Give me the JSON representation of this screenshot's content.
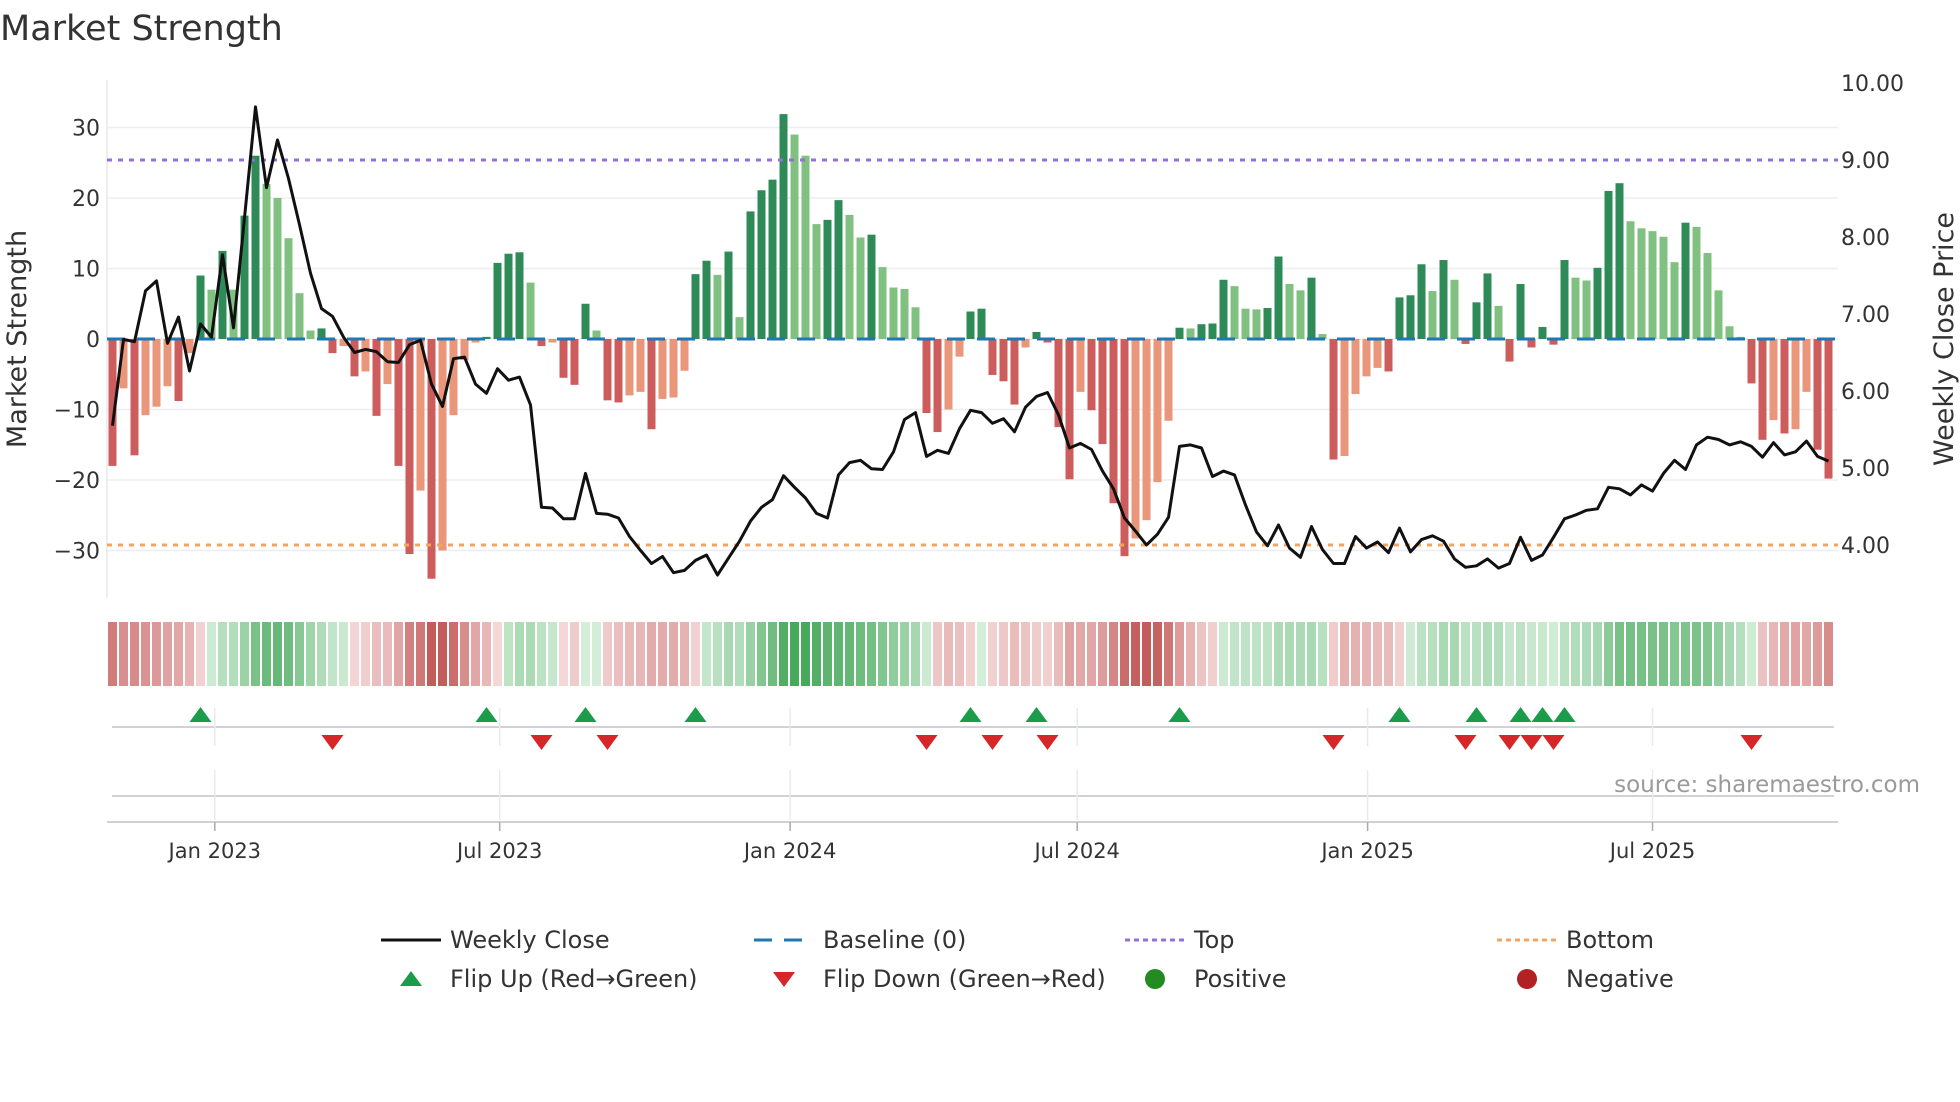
{
  "chart_data": {
    "type": "bar",
    "title": "Market Strength",
    "ylabel": "Market Strength",
    "y2label": "Weekly Close Price",
    "ylim": [
      -36,
      36
    ],
    "y2lim": [
      3.0,
      10.0
    ],
    "grid": true,
    "legend_position": "bottom",
    "yticks": [
      {
        "v": 30,
        "label": "30"
      },
      {
        "v": 20,
        "label": "20"
      },
      {
        "v": 10,
        "label": "10"
      },
      {
        "v": 0,
        "label": "0"
      },
      {
        "v": -10,
        "label": "−10"
      },
      {
        "v": -20,
        "label": "−20"
      },
      {
        "v": -30,
        "label": "−30"
      }
    ],
    "y2ticks": [
      {
        "v": 10,
        "label": "10.00"
      },
      {
        "v": 9,
        "label": "9.00"
      },
      {
        "v": 8,
        "label": "8.00"
      },
      {
        "v": 7,
        "label": "7.00"
      },
      {
        "v": 6,
        "label": "6.00"
      },
      {
        "v": 5,
        "label": "5.00"
      },
      {
        "v": 4,
        "label": "4.00"
      }
    ],
    "xticks": [
      {
        "week": 9.3,
        "label": "Jan 2023"
      },
      {
        "week": 35.2,
        "label": "Jul 2023"
      },
      {
        "week": 61.6,
        "label": "Jan 2024"
      },
      {
        "week": 87.7,
        "label": "Jul 2024"
      },
      {
        "week": 114.1,
        "label": "Jan 2025"
      },
      {
        "week": 140.0,
        "label": "Jul 2025"
      }
    ],
    "top_level_price": 9.0,
    "bottom_level_price": 4.0,
    "strength": [
      -18,
      -7,
      -16.5,
      -10.8,
      -9.6,
      -6.7,
      -8.8,
      -2,
      9,
      7,
      12.5,
      7,
      17.5,
      26,
      22,
      20,
      14.3,
      6.5,
      1.2,
      1.5,
      -2,
      -1,
      -5.3,
      -4.6,
      -10.9,
      -6.4,
      -18,
      -30.5,
      -21.5,
      -34,
      -30,
      -10.8,
      -3,
      -0.5,
      0.3,
      10.8,
      12.1,
      12.3,
      8,
      -1,
      -0.5,
      -5.5,
      -6.5,
      5,
      1.2,
      -8.7,
      -9,
      -8,
      -7.5,
      -12.8,
      -8.5,
      -8.3,
      -4.5,
      9.2,
      11.1,
      9.1,
      12.4,
      3.1,
      18.1,
      21.1,
      22.6,
      31.9,
      29.0,
      26.0,
      16.3,
      16.9,
      19.7,
      17.6,
      14.4,
      14.8,
      10.2,
      7.3,
      7.1,
      4.5,
      -10.5,
      -13.2,
      -10.0,
      -2.5,
      3.9,
      4.3,
      -5.1,
      -6.0,
      -9.3,
      -1.2,
      1.0,
      -0.5,
      -12.5,
      -19.9,
      -7.5,
      -10.1,
      -14.9,
      -23.3,
      -30.8,
      -28.3,
      -25.7,
      -20.3,
      -11.6,
      1.6,
      1.5,
      2.1,
      2.2,
      8.4,
      7.5,
      4.3,
      4.2,
      4.4,
      11.7,
      7.8,
      6.9,
      8.7,
      0.7,
      -17.1,
      -16.6,
      -7.8,
      -5.3,
      -4.1,
      -4.6,
      5.9,
      6.2,
      10.6,
      6.8,
      11.2,
      8.4,
      -0.7,
      5.2,
      9.3,
      4.7,
      -3.2,
      7.8,
      -1.2,
      1.7,
      -0.8,
      11.2,
      8.7,
      8.3,
      10.1,
      21.0,
      22.1,
      16.7,
      15.7,
      15.3,
      14.5,
      10.9,
      16.5,
      15.9,
      12.2,
      6.9,
      1.8,
      0.3,
      -6.3,
      -14.3,
      -11.5,
      -13.4,
      -12.8,
      -7.5,
      -15.7,
      -19.8
    ],
    "weekly_close": [
      5.55,
      6.67,
      6.64,
      7.3,
      7.43,
      6.62,
      6.96,
      6.26,
      6.87,
      6.7,
      7.77,
      6.82,
      8.25,
      9.69,
      8.64,
      9.26,
      8.76,
      8.16,
      7.53,
      7.07,
      6.97,
      6.7,
      6.5,
      6.54,
      6.51,
      6.38,
      6.37,
      6.6,
      6.66,
      6.09,
      5.8,
      6.42,
      6.44,
      6.09,
      5.97,
      6.29,
      6.14,
      6.18,
      5.82,
      4.49,
      4.48,
      4.34,
      4.34,
      4.93,
      4.41,
      4.4,
      4.35,
      4.11,
      3.93,
      3.76,
      3.85,
      3.64,
      3.67,
      3.8,
      3.87,
      3.61,
      3.83,
      4.05,
      4.31,
      4.49,
      4.59,
      4.9,
      4.75,
      4.61,
      4.41,
      4.35,
      4.91,
      5.07,
      5.1,
      4.99,
      4.98,
      5.21,
      5.63,
      5.72,
      5.15,
      5.23,
      5.19,
      5.51,
      5.75,
      5.72,
      5.58,
      5.64,
      5.47,
      5.79,
      5.93,
      5.98,
      5.69,
      5.26,
      5.32,
      5.24,
      4.96,
      4.73,
      4.35,
      4.18,
      4.0,
      4.14,
      4.36,
      5.28,
      5.3,
      5.26,
      4.89,
      4.96,
      4.91,
      4.52,
      4.17,
      3.99,
      4.26,
      3.96,
      3.84,
      4.24,
      3.94,
      3.76,
      3.76,
      4.11,
      3.96,
      4.04,
      3.9,
      4.22,
      3.91,
      4.07,
      4.12,
      4.05,
      3.82,
      3.71,
      3.73,
      3.82,
      3.7,
      3.76,
      4.1,
      3.8,
      3.87,
      4.1,
      4.34,
      4.39,
      4.45,
      4.47,
      4.75,
      4.73,
      4.65,
      4.78,
      4.7,
      4.93,
      5.1,
      4.98,
      5.3,
      5.4,
      5.37,
      5.3,
      5.34,
      5.28,
      5.14,
      5.33,
      5.17,
      5.21,
      5.35,
      5.15,
      5.09
    ],
    "legend": [
      {
        "key": "close",
        "label": "Weekly Close"
      },
      {
        "key": "baseline",
        "label": "Baseline (0)"
      },
      {
        "key": "top",
        "label": "Top"
      },
      {
        "key": "bottom",
        "label": "Bottom"
      },
      {
        "key": "flip_up",
        "label": "Flip Up (Red→Green)"
      },
      {
        "key": "flip_down",
        "label": "Flip Down (Green→Red)"
      },
      {
        "key": "positive",
        "label": "Positive"
      },
      {
        "key": "negative",
        "label": "Negative"
      }
    ],
    "source": "source: sharemaestro.com"
  },
  "colors": {
    "pos_strong": "#2e8b57",
    "pos_weak": "#80c080",
    "neg_strong": "#cd5c5c",
    "neg_weak": "#e9967a",
    "close": "#111111",
    "baseline": "#1f77b4",
    "top": "#9370db",
    "bottom": "#f4a460",
    "flip_up": "#1a9c4a",
    "flip_down": "#d62728",
    "positive": "#228b22",
    "negative": "#b22222"
  }
}
